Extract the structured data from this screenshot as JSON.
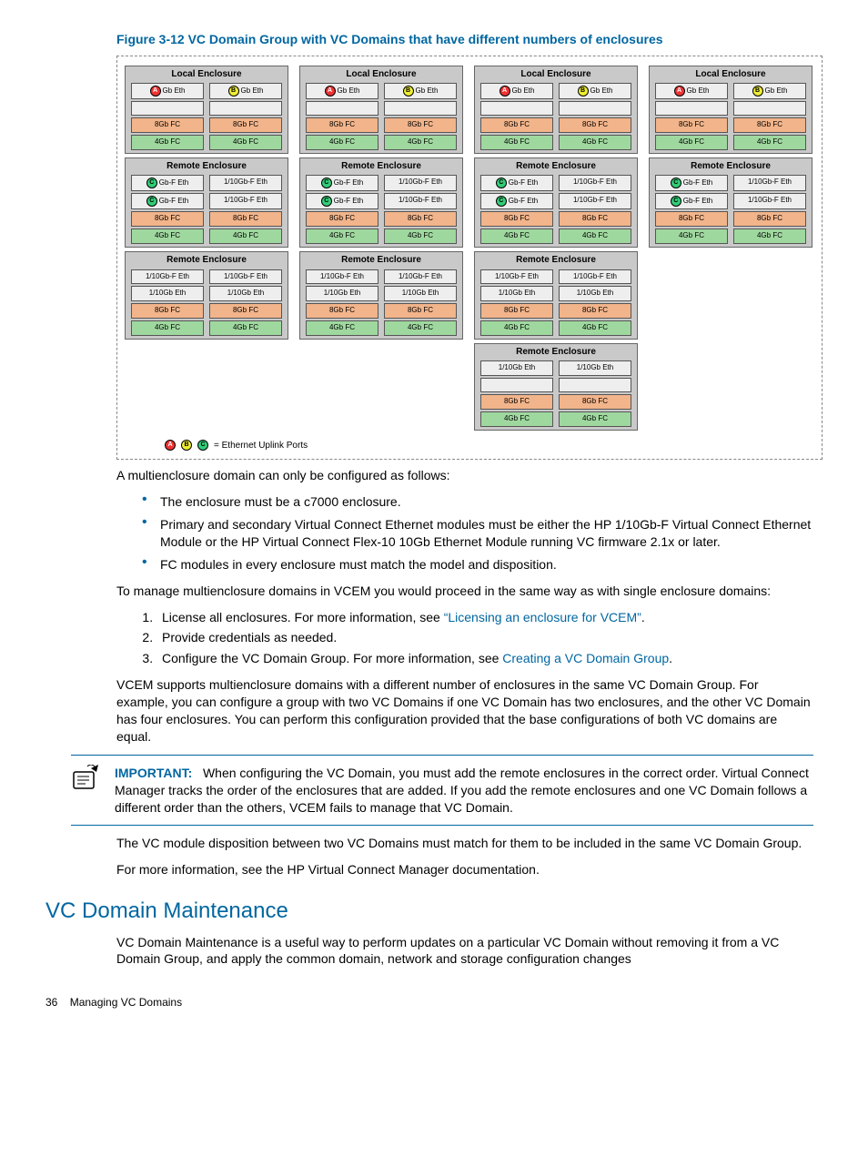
{
  "figure": {
    "title": "Figure 3-12 VC Domain Group with VC Domains that have different numbers of enclosures",
    "legend_label": "= Ethernet Uplink Ports",
    "legend_ports": [
      "A",
      "B",
      "C"
    ],
    "columns": [
      {
        "enclosures": [
          {
            "title": "Local Enclosure",
            "rows": [
              {
                "l": {
                  "port": "A",
                  "t": "Gb Eth"
                },
                "r": {
                  "port": "B",
                  "t": "Gb Eth"
                }
              },
              {
                "l": {
                  "t": "",
                  "e": true
                },
                "r": {
                  "t": "",
                  "e": true
                }
              },
              {
                "l": {
                  "t": "8Gb FC",
                  "c": "fc8"
                },
                "r": {
                  "t": "8Gb FC",
                  "c": "fc8"
                }
              },
              {
                "l": {
                  "t": "4Gb FC",
                  "c": "fc4"
                },
                "r": {
                  "t": "4Gb FC",
                  "c": "fc4"
                }
              }
            ]
          },
          {
            "title": "Remote Enclosure",
            "rows": [
              {
                "l": {
                  "port": "C",
                  "t": "Gb-F Eth"
                },
                "r": {
                  "t": "1/10Gb-F Eth"
                }
              },
              {
                "l": {
                  "port": "C",
                  "t": "Gb-F Eth"
                },
                "r": {
                  "t": "1/10Gb-F Eth"
                }
              },
              {
                "l": {
                  "t": "8Gb FC",
                  "c": "fc8"
                },
                "r": {
                  "t": "8Gb FC",
                  "c": "fc8"
                }
              },
              {
                "l": {
                  "t": "4Gb FC",
                  "c": "fc4"
                },
                "r": {
                  "t": "4Gb FC",
                  "c": "fc4"
                }
              }
            ]
          },
          {
            "title": "Remote Enclosure",
            "rows": [
              {
                "l": {
                  "t": "1/10Gb-F Eth"
                },
                "r": {
                  "t": "1/10Gb-F Eth"
                }
              },
              {
                "l": {
                  "t": "1/10Gb Eth"
                },
                "r": {
                  "t": "1/10Gb Eth"
                }
              },
              {
                "l": {
                  "t": "8Gb FC",
                  "c": "fc8"
                },
                "r": {
                  "t": "8Gb FC",
                  "c": "fc8"
                }
              },
              {
                "l": {
                  "t": "4Gb FC",
                  "c": "fc4"
                },
                "r": {
                  "t": "4Gb FC",
                  "c": "fc4"
                }
              }
            ]
          }
        ]
      },
      {
        "enclosures": [
          {
            "title": "Local Enclosure",
            "rows": [
              {
                "l": {
                  "port": "A",
                  "t": "Gb Eth"
                },
                "r": {
                  "port": "B",
                  "t": "Gb Eth"
                }
              },
              {
                "l": {
                  "t": "",
                  "e": true
                },
                "r": {
                  "t": "",
                  "e": true
                }
              },
              {
                "l": {
                  "t": "8Gb FC",
                  "c": "fc8"
                },
                "r": {
                  "t": "8Gb FC",
                  "c": "fc8"
                }
              },
              {
                "l": {
                  "t": "4Gb FC",
                  "c": "fc4"
                },
                "r": {
                  "t": "4Gb FC",
                  "c": "fc4"
                }
              }
            ]
          },
          {
            "title": "Remote Enclosure",
            "rows": [
              {
                "l": {
                  "port": "C",
                  "t": "Gb-F Eth"
                },
                "r": {
                  "t": "1/10Gb-F Eth"
                }
              },
              {
                "l": {
                  "port": "C",
                  "t": "Gb-F Eth"
                },
                "r": {
                  "t": "1/10Gb-F Eth"
                }
              },
              {
                "l": {
                  "t": "8Gb FC",
                  "c": "fc8"
                },
                "r": {
                  "t": "8Gb FC",
                  "c": "fc8"
                }
              },
              {
                "l": {
                  "t": "4Gb FC",
                  "c": "fc4"
                },
                "r": {
                  "t": "4Gb FC",
                  "c": "fc4"
                }
              }
            ]
          },
          {
            "title": "Remote Enclosure",
            "rows": [
              {
                "l": {
                  "t": "1/10Gb-F Eth"
                },
                "r": {
                  "t": "1/10Gb-F Eth"
                }
              },
              {
                "l": {
                  "t": "1/10Gb Eth"
                },
                "r": {
                  "t": "1/10Gb Eth"
                }
              },
              {
                "l": {
                  "t": "8Gb FC",
                  "c": "fc8"
                },
                "r": {
                  "t": "8Gb FC",
                  "c": "fc8"
                }
              },
              {
                "l": {
                  "t": "4Gb FC",
                  "c": "fc4"
                },
                "r": {
                  "t": "4Gb FC",
                  "c": "fc4"
                }
              }
            ]
          }
        ]
      },
      {
        "enclosures": [
          {
            "title": "Local Enclosure",
            "rows": [
              {
                "l": {
                  "port": "A",
                  "t": "Gb Eth"
                },
                "r": {
                  "port": "B",
                  "t": "Gb Eth"
                }
              },
              {
                "l": {
                  "t": "",
                  "e": true
                },
                "r": {
                  "t": "",
                  "e": true
                }
              },
              {
                "l": {
                  "t": "8Gb FC",
                  "c": "fc8"
                },
                "r": {
                  "t": "8Gb FC",
                  "c": "fc8"
                }
              },
              {
                "l": {
                  "t": "4Gb FC",
                  "c": "fc4"
                },
                "r": {
                  "t": "4Gb FC",
                  "c": "fc4"
                }
              }
            ]
          },
          {
            "title": "Remote Enclosure",
            "rows": [
              {
                "l": {
                  "port": "C",
                  "t": "Gb-F Eth"
                },
                "r": {
                  "t": "1/10Gb-F Eth"
                }
              },
              {
                "l": {
                  "port": "C",
                  "t": "Gb-F Eth"
                },
                "r": {
                  "t": "1/10Gb-F Eth"
                }
              },
              {
                "l": {
                  "t": "8Gb FC",
                  "c": "fc8"
                },
                "r": {
                  "t": "8Gb FC",
                  "c": "fc8"
                }
              },
              {
                "l": {
                  "t": "4Gb FC",
                  "c": "fc4"
                },
                "r": {
                  "t": "4Gb FC",
                  "c": "fc4"
                }
              }
            ]
          },
          {
            "title": "Remote Enclosure",
            "rows": [
              {
                "l": {
                  "t": "1/10Gb-F Eth"
                },
                "r": {
                  "t": "1/10Gb-F Eth"
                }
              },
              {
                "l": {
                  "t": "1/10Gb Eth"
                },
                "r": {
                  "t": "1/10Gb Eth"
                }
              },
              {
                "l": {
                  "t": "8Gb FC",
                  "c": "fc8"
                },
                "r": {
                  "t": "8Gb FC",
                  "c": "fc8"
                }
              },
              {
                "l": {
                  "t": "4Gb FC",
                  "c": "fc4"
                },
                "r": {
                  "t": "4Gb FC",
                  "c": "fc4"
                }
              }
            ]
          },
          {
            "title": "Remote Enclosure",
            "rows": [
              {
                "l": {
                  "t": "1/10Gb Eth"
                },
                "r": {
                  "t": "1/10Gb Eth"
                }
              },
              {
                "l": {
                  "t": "",
                  "e": true
                },
                "r": {
                  "t": "",
                  "e": true
                }
              },
              {
                "l": {
                  "t": "8Gb FC",
                  "c": "fc8"
                },
                "r": {
                  "t": "8Gb FC",
                  "c": "fc8"
                }
              },
              {
                "l": {
                  "t": "4Gb FC",
                  "c": "fc4"
                },
                "r": {
                  "t": "4Gb FC",
                  "c": "fc4"
                }
              }
            ]
          }
        ]
      },
      {
        "enclosures": [
          {
            "title": "Local Enclosure",
            "rows": [
              {
                "l": {
                  "port": "A",
                  "t": "Gb Eth"
                },
                "r": {
                  "port": "B",
                  "t": "Gb Eth"
                }
              },
              {
                "l": {
                  "t": "",
                  "e": true
                },
                "r": {
                  "t": "",
                  "e": true
                }
              },
              {
                "l": {
                  "t": "8Gb FC",
                  "c": "fc8"
                },
                "r": {
                  "t": "8Gb FC",
                  "c": "fc8"
                }
              },
              {
                "l": {
                  "t": "4Gb FC",
                  "c": "fc4"
                },
                "r": {
                  "t": "4Gb FC",
                  "c": "fc4"
                }
              }
            ]
          },
          {
            "title": "Remote Enclosure",
            "rows": [
              {
                "l": {
                  "port": "C",
                  "t": "Gb-F Eth"
                },
                "r": {
                  "t": "1/10Gb-F Eth"
                }
              },
              {
                "l": {
                  "port": "C",
                  "t": "Gb-F Eth"
                },
                "r": {
                  "t": "1/10Gb-F Eth"
                }
              },
              {
                "l": {
                  "t": "8Gb FC",
                  "c": "fc8"
                },
                "r": {
                  "t": "8Gb FC",
                  "c": "fc8"
                }
              },
              {
                "l": {
                  "t": "4Gb FC",
                  "c": "fc4"
                },
                "r": {
                  "t": "4Gb FC",
                  "c": "fc4"
                }
              }
            ]
          }
        ]
      }
    ]
  },
  "para1": "A multienclosure domain can only be configured as follows:",
  "bullets": [
    "The enclosure must be a c7000 enclosure.",
    "Primary and secondary Virtual Connect Ethernet modules must be either the HP 1/10Gb-F Virtual Connect Ethernet Module or the HP Virtual Connect Flex-10 10Gb Ethernet Module running VC firmware 2.1x or later.",
    "FC modules in every enclosure must match the model and disposition."
  ],
  "para2": "To manage multienclosure domains in VCEM you would proceed in the same way as with single enclosure domains:",
  "steps": {
    "s1a": "License all enclosures. For more information, see ",
    "s1link": "“Licensing an enclosure for VCEM”",
    "s1b": ".",
    "s2": "Provide credentials as needed.",
    "s3a": "Configure the VC Domain Group. For more information, see ",
    "s3link": "Creating a VC Domain Group",
    "s3b": "."
  },
  "para3": "VCEM supports multienclosure domains with a different number of enclosures in the same VC Domain Group. For example, you can configure a group with two VC Domains if one VC Domain has two enclosures, and the other VC Domain has four enclosures. You can perform this configuration provided that the base configurations of both VC domains are equal.",
  "note": {
    "label": "IMPORTANT:",
    "text": "When configuring the VC Domain, you must add the remote enclosures in the correct order. Virtual Connect Manager tracks the order of the enclosures that are added. If you add the remote enclosures and one VC Domain follows a different order than the others, VCEM fails to manage that VC Domain."
  },
  "para4": "The VC module disposition between two VC Domains must match for them to be included in the same VC Domain Group.",
  "para5": "For more information, see the HP Virtual Connect Manager documentation.",
  "section_title": "VC Domain Maintenance",
  "para6": "VC Domain Maintenance is a useful way to perform updates on a particular VC Domain without removing it from a VC Domain Group, and apply the common domain, network and storage configuration changes",
  "footer": {
    "page": "36",
    "title": "Managing VC Domains"
  }
}
